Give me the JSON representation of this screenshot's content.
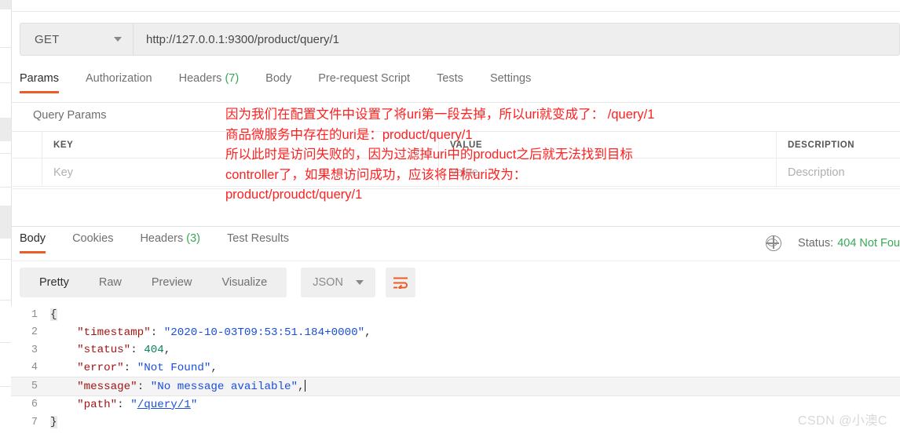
{
  "request": {
    "method": "GET",
    "url": "http://127.0.0.1:9300/product/query/1",
    "tabs": [
      {
        "label": "Params",
        "count": "",
        "active": true
      },
      {
        "label": "Authorization",
        "count": "",
        "active": false
      },
      {
        "label": "Headers",
        "count": "(7)",
        "active": false
      },
      {
        "label": "Body",
        "count": "",
        "active": false
      },
      {
        "label": "Pre-request Script",
        "count": "",
        "active": false
      },
      {
        "label": "Tests",
        "count": "",
        "active": false
      },
      {
        "label": "Settings",
        "count": "",
        "active": false
      }
    ]
  },
  "query_params": {
    "title": "Query Params",
    "headers": {
      "key": "KEY",
      "value": "VALUE",
      "description": "DESCRIPTION"
    },
    "rows": [
      {
        "key": "Key",
        "value": "Value",
        "description": "Description"
      }
    ]
  },
  "annotation": {
    "color": "#ff2020",
    "lines": [
      "因为我们在配置文件中设置了将uri第一段去掉，所以uri就变成了： /query/1",
      "商品微服务中存在的uri是：product/query/1",
      "所以此时是访问失败的，因为过滤掉uri中的product之后就无法找到目标",
      "controller了，如果想访问成功，应该将目标uri改为：",
      "product/proudct/query/1"
    ]
  },
  "response": {
    "tabs": [
      {
        "label": "Body",
        "count": "",
        "active": true
      },
      {
        "label": "Cookies",
        "count": "",
        "active": false
      },
      {
        "label": "Headers",
        "count": "(3)",
        "active": false
      },
      {
        "label": "Test Results",
        "count": "",
        "active": false
      }
    ],
    "status_label": "Status:",
    "status_value": "404 Not Fou",
    "globe_icon": "globe-icon",
    "view_modes": [
      {
        "label": "Pretty",
        "active": true
      },
      {
        "label": "Raw",
        "active": false
      },
      {
        "label": "Preview",
        "active": false
      },
      {
        "label": "Visualize",
        "active": false
      }
    ],
    "format": "JSON",
    "wrap_icon": "wrap-lines-icon",
    "wrap_icon_color": "#ef5b25",
    "body_lines": [
      {
        "n": "1",
        "highlight": false,
        "tokens": [
          {
            "t": "{",
            "c": "brace"
          }
        ]
      },
      {
        "n": "2",
        "highlight": false,
        "tokens": [
          {
            "t": "    ",
            "c": "p"
          },
          {
            "t": "\"timestamp\"",
            "c": "k"
          },
          {
            "t": ": ",
            "c": "p"
          },
          {
            "t": "\"2020-10-03T09:53:51.184+0000\"",
            "c": "s"
          },
          {
            "t": ",",
            "c": "p"
          }
        ]
      },
      {
        "n": "3",
        "highlight": false,
        "tokens": [
          {
            "t": "    ",
            "c": "p"
          },
          {
            "t": "\"status\"",
            "c": "k"
          },
          {
            "t": ": ",
            "c": "p"
          },
          {
            "t": "404",
            "c": "n"
          },
          {
            "t": ",",
            "c": "p"
          }
        ]
      },
      {
        "n": "4",
        "highlight": false,
        "tokens": [
          {
            "t": "    ",
            "c": "p"
          },
          {
            "t": "\"error\"",
            "c": "k"
          },
          {
            "t": ": ",
            "c": "p"
          },
          {
            "t": "\"Not Found\"",
            "c": "s"
          },
          {
            "t": ",",
            "c": "p"
          }
        ]
      },
      {
        "n": "5",
        "highlight": true,
        "cursor": true,
        "tokens": [
          {
            "t": "    ",
            "c": "p"
          },
          {
            "t": "\"message\"",
            "c": "k"
          },
          {
            "t": ": ",
            "c": "p"
          },
          {
            "t": "\"No message available\"",
            "c": "s"
          },
          {
            "t": ",",
            "c": "p"
          }
        ]
      },
      {
        "n": "6",
        "highlight": false,
        "tokens": [
          {
            "t": "    ",
            "c": "p"
          },
          {
            "t": "\"path\"",
            "c": "k"
          },
          {
            "t": ": ",
            "c": "p"
          },
          {
            "t": "\"",
            "c": "s"
          },
          {
            "t": "/query/1",
            "c": "s u"
          },
          {
            "t": "\"",
            "c": "s"
          }
        ]
      },
      {
        "n": "7",
        "highlight": false,
        "tokens": [
          {
            "t": "}",
            "c": "brace"
          }
        ]
      }
    ]
  },
  "watermark": "CSDN @小澳C",
  "colors": {
    "accent": "#ef5b25",
    "green": "#3aa757",
    "red": "#ff2020"
  }
}
